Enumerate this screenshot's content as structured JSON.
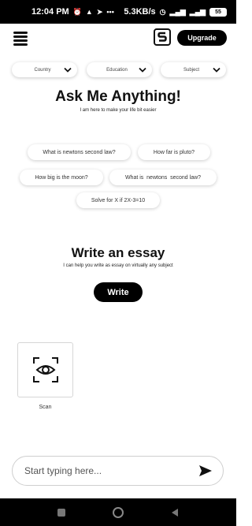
{
  "status_bar": {
    "time": "12:04 PM",
    "notif_icons": [
      "alarm-icon",
      "alert-icon",
      "telegram-icon",
      "more-dots-icon"
    ],
    "net_speed": "5.3KB/s",
    "signal_icons": [
      "alarm-clock-icon",
      "sim-signal-icon",
      "wifi-signal-icon"
    ],
    "battery": "55"
  },
  "header": {
    "menu_icon": "hamburger-menu-icon",
    "logo_icon": "s-logo-icon",
    "upgrade_label": "Upgrade"
  },
  "filters": [
    {
      "label": "Country",
      "icon": "chevron-down-icon"
    },
    {
      "label": "Education",
      "icon": "chevron-down-icon"
    },
    {
      "label": "Subject",
      "icon": "chevron-down-icon"
    }
  ],
  "ask": {
    "title": "Ask Me Anything!",
    "subtitle": "I am here to make your life bit easier",
    "suggestions": [
      "What is newtons second law?",
      "How far is pluto?",
      "How big is the moon?",
      "What is  newtons  second law?",
      "Solve for X if 2X-3=10"
    ]
  },
  "essay": {
    "title": "Write an essay",
    "subtitle": "I can help you write as essay on virtually any subject",
    "button_label": "Write"
  },
  "tools": [
    {
      "label": "Scan",
      "icon": "eye-scan-icon"
    }
  ],
  "composer": {
    "placeholder": "Start typing here...",
    "send_icon": "send-icon"
  },
  "nav_bar": {
    "icons": [
      "recent-apps-icon",
      "home-icon",
      "back-icon"
    ]
  },
  "colors": {
    "accent": "#000000",
    "background": "#ffffff",
    "chip_text": "#333333"
  }
}
